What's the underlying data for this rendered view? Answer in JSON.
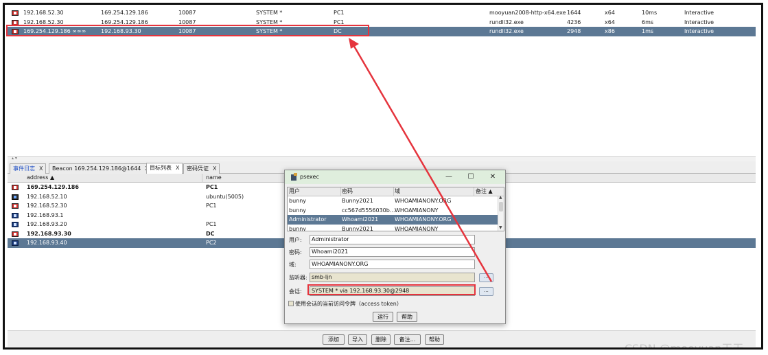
{
  "sessions": {
    "rows": [
      {
        "external": "192.168.52.30",
        "internal": "169.254.129.186",
        "listener": "10087",
        "user": "SYSTEM *",
        "computer": "PC1",
        "process": "mooyuan2008-http-x64.exe",
        "pid": "1644",
        "arch": "x64",
        "last": "10ms",
        "note": "Interactive",
        "icon": "beacon-admin",
        "selected": false
      },
      {
        "external": "192.168.52.30",
        "internal": "169.254.129.186",
        "listener": "10087",
        "user": "SYSTEM *",
        "computer": "PC1",
        "process": "rundll32.exe",
        "pid": "4236",
        "arch": "x64",
        "last": "6ms",
        "note": "Interactive",
        "icon": "beacon-admin",
        "selected": false
      },
      {
        "external": "169.254.129.186 ∞∞∞",
        "internal": "192.168.93.30",
        "listener": "10087",
        "user": "SYSTEM *",
        "computer": "DC",
        "process": "rundll32.exe",
        "pid": "2948",
        "arch": "x86",
        "last": "1ms",
        "note": "Interactive",
        "icon": "beacon-admin",
        "selected": true
      }
    ]
  },
  "tabs": [
    {
      "label": "事件日志",
      "close": "X",
      "active": false,
      "blue": true
    },
    {
      "label": "Beacon 169.254.129.186@1644",
      "close": "X",
      "active": false,
      "blue": false
    },
    {
      "label": "目标列表",
      "close": "X",
      "active": true,
      "blue": false
    },
    {
      "label": "密码凭证",
      "close": "X",
      "active": false,
      "blue": false
    }
  ],
  "targets": {
    "headers": {
      "address": "address ▲",
      "name": "name"
    },
    "rows": [
      {
        "address": "169.254.129.186",
        "name": "PC1",
        "icon": "windows-compromised",
        "bold": true,
        "selected": false
      },
      {
        "address": "192.168.52.10",
        "name": "ubuntu(5005)",
        "icon": "linux",
        "bold": false,
        "selected": false
      },
      {
        "address": "192.168.52.30",
        "name": "PC1",
        "icon": "windows-compromised",
        "bold": false,
        "selected": false
      },
      {
        "address": "192.168.93.1",
        "name": "",
        "icon": "host",
        "bold": false,
        "selected": false
      },
      {
        "address": "192.168.93.20",
        "name": "PC1",
        "icon": "windows",
        "bold": false,
        "selected": false
      },
      {
        "address": "192.168.93.30",
        "name": "DC",
        "icon": "windows-compromised",
        "bold": true,
        "selected": false
      },
      {
        "address": "192.168.93.40",
        "name": "PC2",
        "icon": "windows",
        "bold": false,
        "selected": true
      }
    ],
    "buttons": {
      "add": "添加",
      "import": "导入",
      "remove": "删除",
      "note": "备注...",
      "help": "帮助"
    }
  },
  "dialog": {
    "title": "psexec",
    "controls": {
      "minimize": "—",
      "maximize": "☐",
      "close": "✕"
    },
    "cred_headers": {
      "user": "用户",
      "password": "密码",
      "domain": "域",
      "note": "备注 ▲"
    },
    "creds": [
      {
        "user": "bunny",
        "password": "Bunny2021",
        "domain": "WHOAMIANONY.ORG",
        "selected": false
      },
      {
        "user": "bunny",
        "password": "cc567d5556030b...",
        "domain": "WHOAMIANONY",
        "selected": false
      },
      {
        "user": "Administrator",
        "password": "Whoami2021",
        "domain": "WHOAMIANONY.ORG",
        "selected": true
      },
      {
        "user": "bunny",
        "password": "Bunny2021",
        "domain": "WHOAMIANONY",
        "selected": false
      }
    ],
    "fields": {
      "user_label": "用户:",
      "user": "Administrator",
      "password_label": "密码:",
      "password": "Whoami2021",
      "domain_label": "域:",
      "domain": "WHOAMIANONY.ORG",
      "listener_label": "监听器:",
      "listener": "smb-ljn",
      "session_label": "会话:",
      "session": "SYSTEM * via  192.168.93.30@2948"
    },
    "browse": "...",
    "token_checkbox": "使用会话的当前访问令牌（access token）",
    "token_checked": false,
    "run": "运行",
    "help": "帮助"
  },
  "watermark": "CSDN @mooyuan天天",
  "colors": {
    "selection": "#5c7894",
    "annotation": "#e5343d",
    "dialog_title": "#dfeedd",
    "tab_blue": "#1f4fc4"
  }
}
